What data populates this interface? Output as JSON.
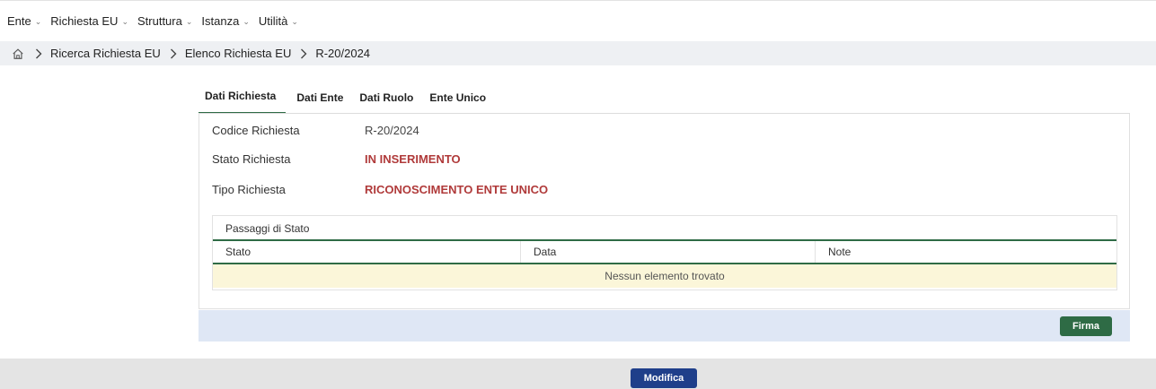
{
  "menu": {
    "items": [
      {
        "label": "Ente"
      },
      {
        "label": "Richiesta EU"
      },
      {
        "label": "Struttura"
      },
      {
        "label": "Istanza"
      },
      {
        "label": "Utilità"
      }
    ]
  },
  "breadcrumb": {
    "home_icon": "home-icon",
    "items": [
      "Ricerca Richiesta EU",
      "Elenco Richiesta EU",
      "R-20/2024"
    ]
  },
  "tabs": [
    {
      "label": "Dati Richiesta",
      "active": true
    },
    {
      "label": "Dati Ente",
      "active": false
    },
    {
      "label": "Dati Ruolo",
      "active": false
    },
    {
      "label": "Ente Unico",
      "active": false
    }
  ],
  "details": {
    "codice_label": "Codice Richiesta",
    "codice_value": "R-20/2024",
    "stato_label": "Stato Richiesta",
    "stato_value": "IN INSERIMENTO",
    "tipo_label": "Tipo Richiesta",
    "tipo_value": "RICONOSCIMENTO ENTE UNICO"
  },
  "grid": {
    "caption": "Passaggi di Stato",
    "columns": [
      "Stato",
      "Data",
      "Note"
    ],
    "empty_message": "Nessun elemento trovato"
  },
  "actions": {
    "firma_label": "Firma",
    "modifica_label": "Modifica"
  },
  "colors": {
    "accent_green": "#2e6b45",
    "status_red": "#b03a3a",
    "primary_blue": "#1f3f8a"
  }
}
